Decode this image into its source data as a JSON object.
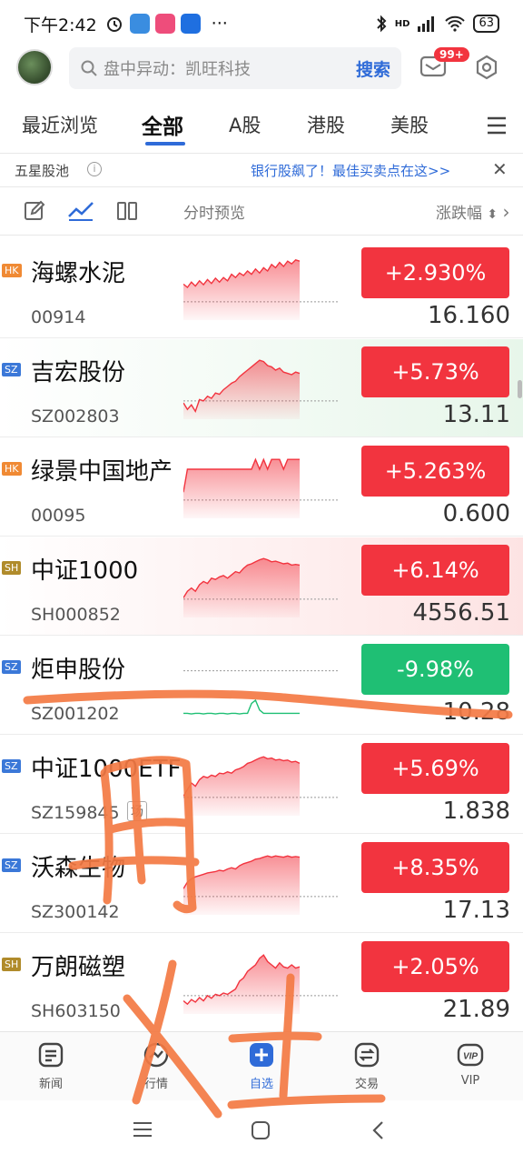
{
  "status_bar": {
    "time": "下午2:42",
    "more": "···",
    "network": "HD",
    "battery": "63"
  },
  "header": {
    "search_placeholder": "盘中异动：凯旺科技",
    "search_button": "搜索",
    "mail_badge": "99+"
  },
  "tabs": [
    {
      "label": "最近浏览",
      "active": false
    },
    {
      "label": "全部",
      "active": true
    },
    {
      "label": "A股",
      "active": false
    },
    {
      "label": "港股",
      "active": false
    },
    {
      "label": "美股",
      "active": false
    }
  ],
  "promo": {
    "pool_label": "五星股池",
    "info_glyph": "i",
    "ad_text": "银行股飙了！最佳买卖点在这>>",
    "close_glyph": "✕"
  },
  "toolbar": {
    "preview_label": "分时预览",
    "change_label": "涨跌幅",
    "sort_glyph": "⬍"
  },
  "stocks": [
    {
      "market": "HK",
      "name": "海螺水泥",
      "code": "00914",
      "tag": "",
      "change": "+2.930%",
      "price": "16.160",
      "direction": "up",
      "bg": "",
      "trend": [
        0.45,
        0.5,
        0.42,
        0.48,
        0.4,
        0.46,
        0.38,
        0.44,
        0.36,
        0.42,
        0.35,
        0.4,
        0.3,
        0.35,
        0.28,
        0.32,
        0.25,
        0.3,
        0.22,
        0.28,
        0.2,
        0.25,
        0.15,
        0.2,
        0.12,
        0.18,
        0.1,
        0.14,
        0.08,
        0.1
      ]
    },
    {
      "market": "SZ",
      "name": "吉宏股份",
      "code": "SZ002803",
      "tag": "",
      "change": "+5.73%",
      "price": "13.11",
      "direction": "up",
      "bg": "green",
      "trend": [
        0.75,
        0.85,
        0.78,
        0.88,
        0.7,
        0.72,
        0.65,
        0.68,
        0.6,
        0.62,
        0.55,
        0.5,
        0.45,
        0.42,
        0.35,
        0.3,
        0.25,
        0.2,
        0.15,
        0.1,
        0.12,
        0.18,
        0.2,
        0.25,
        0.22,
        0.28,
        0.3,
        0.32,
        0.28,
        0.3
      ]
    },
    {
      "market": "HK",
      "name": "绿景中国地产",
      "code": "00095",
      "tag": "",
      "change": "+5.263%",
      "price": "0.600",
      "direction": "up",
      "bg": "",
      "trend": [
        0.6,
        0.25,
        0.25,
        0.25,
        0.25,
        0.25,
        0.25,
        0.25,
        0.25,
        0.25,
        0.25,
        0.25,
        0.25,
        0.25,
        0.25,
        0.25,
        0.25,
        0.25,
        0.1,
        0.25,
        0.1,
        0.25,
        0.1,
        0.1,
        0.1,
        0.25,
        0.1,
        0.1,
        0.1,
        0.1
      ]
    },
    {
      "market": "SH",
      "name": "中证1000",
      "code": "SH000852",
      "tag": "",
      "change": "+6.14%",
      "price": "4556.51",
      "direction": "up",
      "bg": "red",
      "trend": [
        0.7,
        0.6,
        0.55,
        0.6,
        0.5,
        0.45,
        0.48,
        0.4,
        0.42,
        0.38,
        0.36,
        0.4,
        0.35,
        0.3,
        0.32,
        0.25,
        0.2,
        0.18,
        0.15,
        0.12,
        0.1,
        0.12,
        0.15,
        0.14,
        0.16,
        0.18,
        0.17,
        0.2,
        0.19,
        0.2
      ]
    },
    {
      "market": "SZ",
      "name": "炬申股份",
      "code": "SZ001202",
      "tag": "",
      "change": "-9.98%",
      "price": "10.28",
      "direction": "down",
      "bg": "",
      "trend": [
        0.95,
        0.95,
        0.96,
        0.95,
        0.95,
        0.96,
        0.95,
        0.95,
        0.96,
        0.95,
        0.95,
        0.96,
        0.95,
        0.95,
        0.96,
        0.95,
        0.95,
        0.8,
        0.75,
        0.9,
        0.95,
        0.95,
        0.95,
        0.95,
        0.95,
        0.95,
        0.95,
        0.95,
        0.95,
        0.95
      ]
    },
    {
      "market": "SZ",
      "name": "中证1000ETF",
      "code": "SZ159845",
      "tag": "场",
      "change": "+5.69%",
      "price": "1.838",
      "direction": "up",
      "bg": "",
      "trend": [
        0.7,
        0.6,
        0.5,
        0.55,
        0.45,
        0.4,
        0.42,
        0.38,
        0.4,
        0.35,
        0.36,
        0.33,
        0.35,
        0.3,
        0.28,
        0.25,
        0.2,
        0.18,
        0.15,
        0.12,
        0.1,
        0.13,
        0.12,
        0.15,
        0.14,
        0.16,
        0.15,
        0.18,
        0.17,
        0.2
      ]
    },
    {
      "market": "SZ",
      "name": "沃森生物",
      "code": "SZ300142",
      "tag": "",
      "change": "+8.35%",
      "price": "17.13",
      "direction": "up",
      "bg": "",
      "trend": [
        0.6,
        0.5,
        0.45,
        0.42,
        0.4,
        0.38,
        0.36,
        0.35,
        0.34,
        0.32,
        0.33,
        0.3,
        0.28,
        0.3,
        0.25,
        0.22,
        0.2,
        0.18,
        0.15,
        0.14,
        0.12,
        0.1,
        0.12,
        0.1,
        0.11,
        0.12,
        0.1,
        0.12,
        0.11,
        0.12
      ]
    },
    {
      "market": "SH",
      "name": "万朗磁塑",
      "code": "SH603150",
      "tag": "",
      "change": "+2.05%",
      "price": "21.89",
      "direction": "up",
      "bg": "",
      "trend": [
        0.8,
        0.85,
        0.78,
        0.82,
        0.75,
        0.8,
        0.72,
        0.76,
        0.7,
        0.72,
        0.68,
        0.7,
        0.66,
        0.62,
        0.5,
        0.45,
        0.35,
        0.3,
        0.25,
        0.15,
        0.1,
        0.2,
        0.25,
        0.3,
        0.22,
        0.28,
        0.3,
        0.25,
        0.3,
        0.28
      ]
    }
  ],
  "bottom_nav": [
    {
      "label": "新闻",
      "icon": "news-icon",
      "active": false
    },
    {
      "label": "行情",
      "icon": "market-icon",
      "active": false
    },
    {
      "label": "自选",
      "icon": "watchlist-plus-icon",
      "active": true
    },
    {
      "label": "交易",
      "icon": "trade-icon",
      "active": false
    },
    {
      "label": "VIP",
      "icon": "vip-icon",
      "active": false
    }
  ],
  "colors": {
    "up": "#f2343f",
    "down": "#1fbf74",
    "accent": "#2f6bd8",
    "scribble": "#f47a44"
  }
}
